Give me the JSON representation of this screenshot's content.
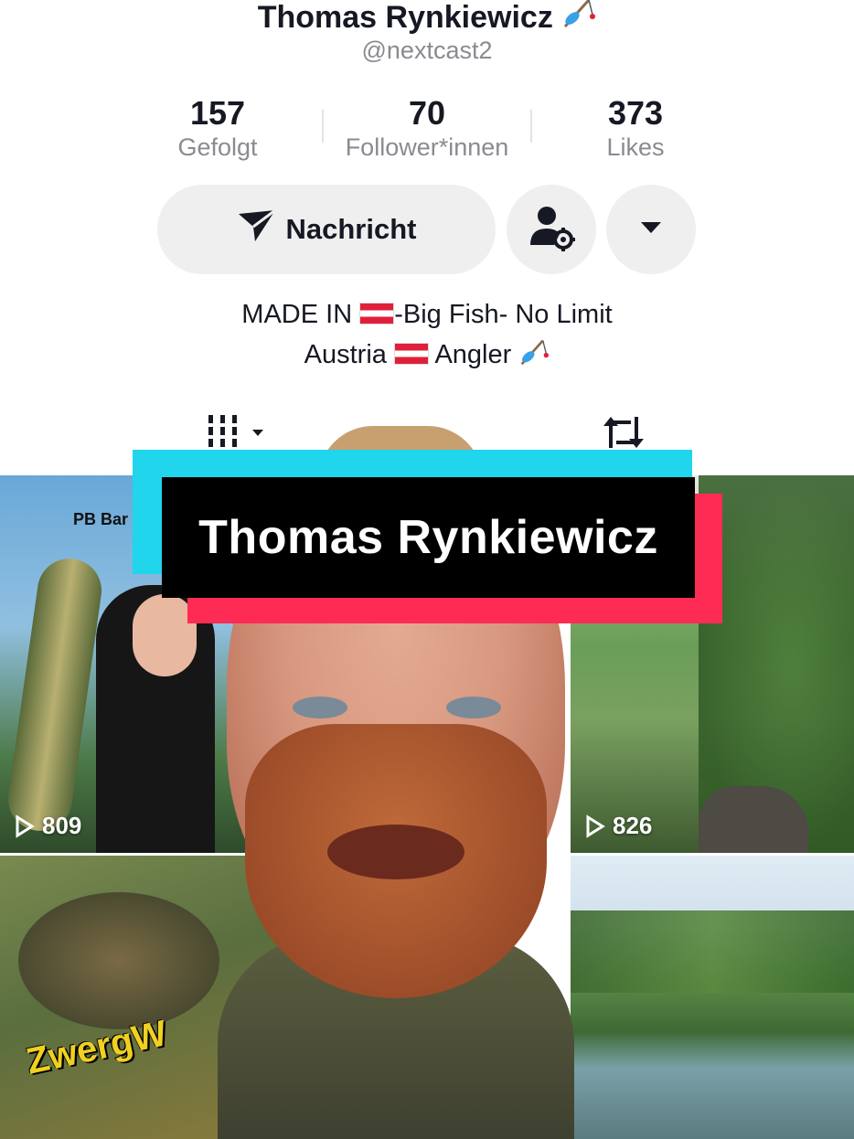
{
  "profile": {
    "name": "Thomas Rynkiewicz",
    "handle": "@nextcast2"
  },
  "stats": [
    {
      "value": "157",
      "label": "Gefolgt"
    },
    {
      "value": "70",
      "label": "Follower*innen"
    },
    {
      "value": "373",
      "label": "Likes"
    }
  ],
  "actions": {
    "message_label": "Nachricht"
  },
  "bio": {
    "line1_prefix": "MADE IN ",
    "line1_suffix": "-Big Fish- No Limit",
    "line2_prefix": "Austria ",
    "line2_suffix": " Angler"
  },
  "videos": [
    {
      "overlay_text": "PB Bar",
      "views": "809"
    },
    {
      "views": "826"
    },
    {
      "overlay_text": "ZwergW"
    },
    {}
  ],
  "overlay_banner": {
    "text": "Thomas Rynkiewicz"
  },
  "colors": {
    "cyan": "#20d5ec",
    "red": "#fe2c55",
    "flag_red": "#e0203a"
  }
}
